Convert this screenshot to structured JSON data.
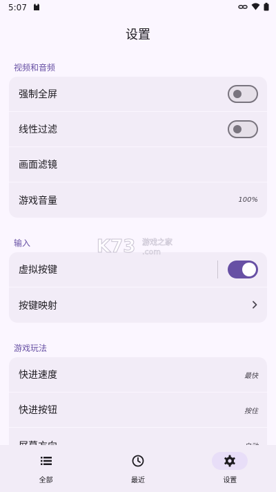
{
  "status_bar": {
    "time": "5:07"
  },
  "title": "设置",
  "sections": {
    "video": {
      "header": "视频和音频",
      "rows": [
        {
          "label": "强制全屏",
          "switch": "off"
        },
        {
          "label": "线性过滤",
          "switch": "off"
        },
        {
          "label": "画面滤镜"
        },
        {
          "label": "游戏音量",
          "value": "100%"
        }
      ]
    },
    "input": {
      "header": "输入",
      "rows": [
        {
          "label": "虚拟按键",
          "switch": "on"
        },
        {
          "label": "按键映射"
        }
      ]
    },
    "gameplay": {
      "header": "游戏玩法",
      "rows": [
        {
          "label": "快进速度",
          "value": "最快"
        },
        {
          "label": "快进按钮",
          "value": "按住"
        },
        {
          "label": "屏幕方向",
          "value": "自动"
        }
      ]
    }
  },
  "bottom_nav": [
    {
      "label": "全部",
      "icon": "list-icon",
      "active": false
    },
    {
      "label": "最近",
      "icon": "clock-icon",
      "active": false
    },
    {
      "label": "设置",
      "icon": "gear-icon",
      "active": true
    }
  ],
  "watermark": {
    "brand": "K73",
    "text1": "游戏之家",
    "text2": ".com"
  },
  "colors": {
    "accent": "#6750a4",
    "background": "#fbf6ff",
    "card": "#f2ecf7"
  }
}
